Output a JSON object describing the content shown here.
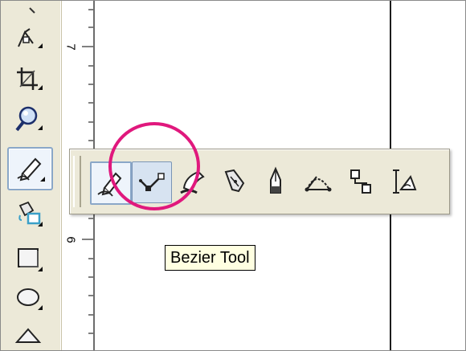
{
  "window": {
    "title": ""
  },
  "toolbox": {
    "tools": [
      {
        "name": "shape-tool",
        "icon": "shape-node-icon"
      },
      {
        "name": "crop-tool",
        "icon": "crop-icon"
      },
      {
        "name": "zoom-tool",
        "icon": "magnifier-icon"
      },
      {
        "name": "freehand-tool",
        "icon": "freehand-pen-icon",
        "active": true
      },
      {
        "name": "smart-fill-tool",
        "icon": "smart-fill-icon"
      },
      {
        "name": "rectangle-tool",
        "icon": "rectangle-icon"
      },
      {
        "name": "ellipse-tool",
        "icon": "ellipse-icon"
      },
      {
        "name": "polygon-tool",
        "icon": "polygon-icon"
      }
    ]
  },
  "ruler": {
    "labels": [
      "7",
      "6"
    ]
  },
  "flyout": {
    "tools": [
      {
        "name": "freehand",
        "icon": "freehand-icon",
        "state": "checked"
      },
      {
        "name": "bezier",
        "icon": "bezier-icon",
        "state": "hover"
      },
      {
        "name": "artistic-media",
        "icon": "artistic-media-icon"
      },
      {
        "name": "pen",
        "icon": "pen-nib-icon"
      },
      {
        "name": "polyline",
        "icon": "polyline-icon"
      },
      {
        "name": "3-point-curve",
        "icon": "three-point-curve-icon"
      },
      {
        "name": "interactive-connector",
        "icon": "connector-icon"
      },
      {
        "name": "dimension",
        "icon": "dimension-icon"
      }
    ]
  },
  "tooltip": {
    "text": "Bezier Tool"
  },
  "colors": {
    "highlight": "#e0187d",
    "toolbar_bg": "#ece9d8",
    "tooltip_bg": "#ffffe1",
    "active_border": "#8aa7c8"
  }
}
